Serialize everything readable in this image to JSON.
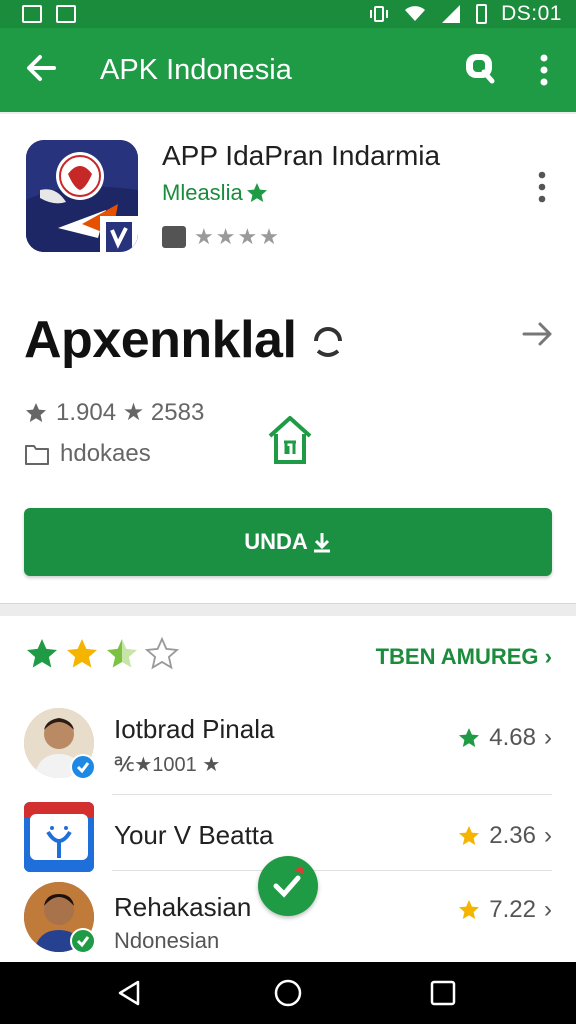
{
  "status_bar": {
    "time": "DS:01"
  },
  "app_bar": {
    "title": "APK Indonesia"
  },
  "app": {
    "name": "APP IdaPran Indarmia",
    "developer": "Mleaslia",
    "small_stars": "★★★★",
    "big_title": "Apxennklal",
    "stats": "1.904 ★ 2583",
    "category": "hdokaes"
  },
  "install_label": "UNDA",
  "reviews": {
    "see_all_label": "TBEN AMUREG",
    "items": [
      {
        "name": "Iotbrad Pinala",
        "sub": "★1001 ★",
        "score": "4.68"
      },
      {
        "name": "Your V Beatta",
        "sub": "",
        "score": "2.36"
      },
      {
        "name": "Rehakasian",
        "sub": "Ndonesian",
        "score": "7.22"
      }
    ]
  },
  "colors": {
    "accent_green": "#1f9a45",
    "status_green": "#1b8b3c",
    "star_gold": "#f4b400"
  }
}
